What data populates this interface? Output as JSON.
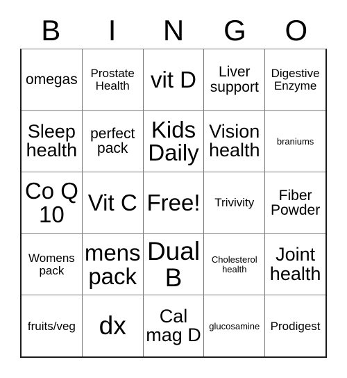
{
  "header": {
    "letters": [
      "B",
      "I",
      "N",
      "G",
      "O"
    ]
  },
  "grid": {
    "rows": [
      [
        {
          "text": "omegas",
          "size": "fs-md"
        },
        {
          "text": "Prostate\nHealth",
          "size": "fs-sm"
        },
        {
          "text": "vit D",
          "size": "fs-xl"
        },
        {
          "text": "Liver\nsupport",
          "size": "fs-md"
        },
        {
          "text": "Digestive\nEnzyme",
          "size": "fs-sm"
        }
      ],
      [
        {
          "text": "Sleep\nhealth",
          "size": "fs-lg"
        },
        {
          "text": "perfect\npack",
          "size": "fs-md"
        },
        {
          "text": "Kids\nDaily",
          "size": "fs-xl"
        },
        {
          "text": "Vision\nhealth",
          "size": "fs-lg"
        },
        {
          "text": "braniums",
          "size": "fs-xs"
        }
      ],
      [
        {
          "text": "Co Q\n10",
          "size": "fs-xl"
        },
        {
          "text": "Vit C",
          "size": "fs-xl"
        },
        {
          "text": "Free!",
          "size": "fs-xl"
        },
        {
          "text": "Trivivity",
          "size": "fs-sm"
        },
        {
          "text": "Fiber\nPowder",
          "size": "fs-md"
        }
      ],
      [
        {
          "text": "Womens\npack",
          "size": "fs-sm"
        },
        {
          "text": "mens\npack",
          "size": "fs-xl"
        },
        {
          "text": "Dual\nB",
          "size": "fs-xxl"
        },
        {
          "text": "Cholesterol\nhealth",
          "size": "fs-xs"
        },
        {
          "text": "Joint\nhealth",
          "size": "fs-lg"
        }
      ],
      [
        {
          "text": "fruits/veg",
          "size": "fs-sm"
        },
        {
          "text": "dx",
          "size": "fs-xxl"
        },
        {
          "text": "Cal\nmag D",
          "size": "fs-lg"
        },
        {
          "text": "glucosamine",
          "size": "fs-xs"
        },
        {
          "text": "Prodigest",
          "size": "fs-sm"
        }
      ]
    ]
  },
  "colors": {
    "background": "#ffffff",
    "text": "#000000",
    "grid_line": "#7a7a7a",
    "grid_border": "#1a1a1a"
  }
}
